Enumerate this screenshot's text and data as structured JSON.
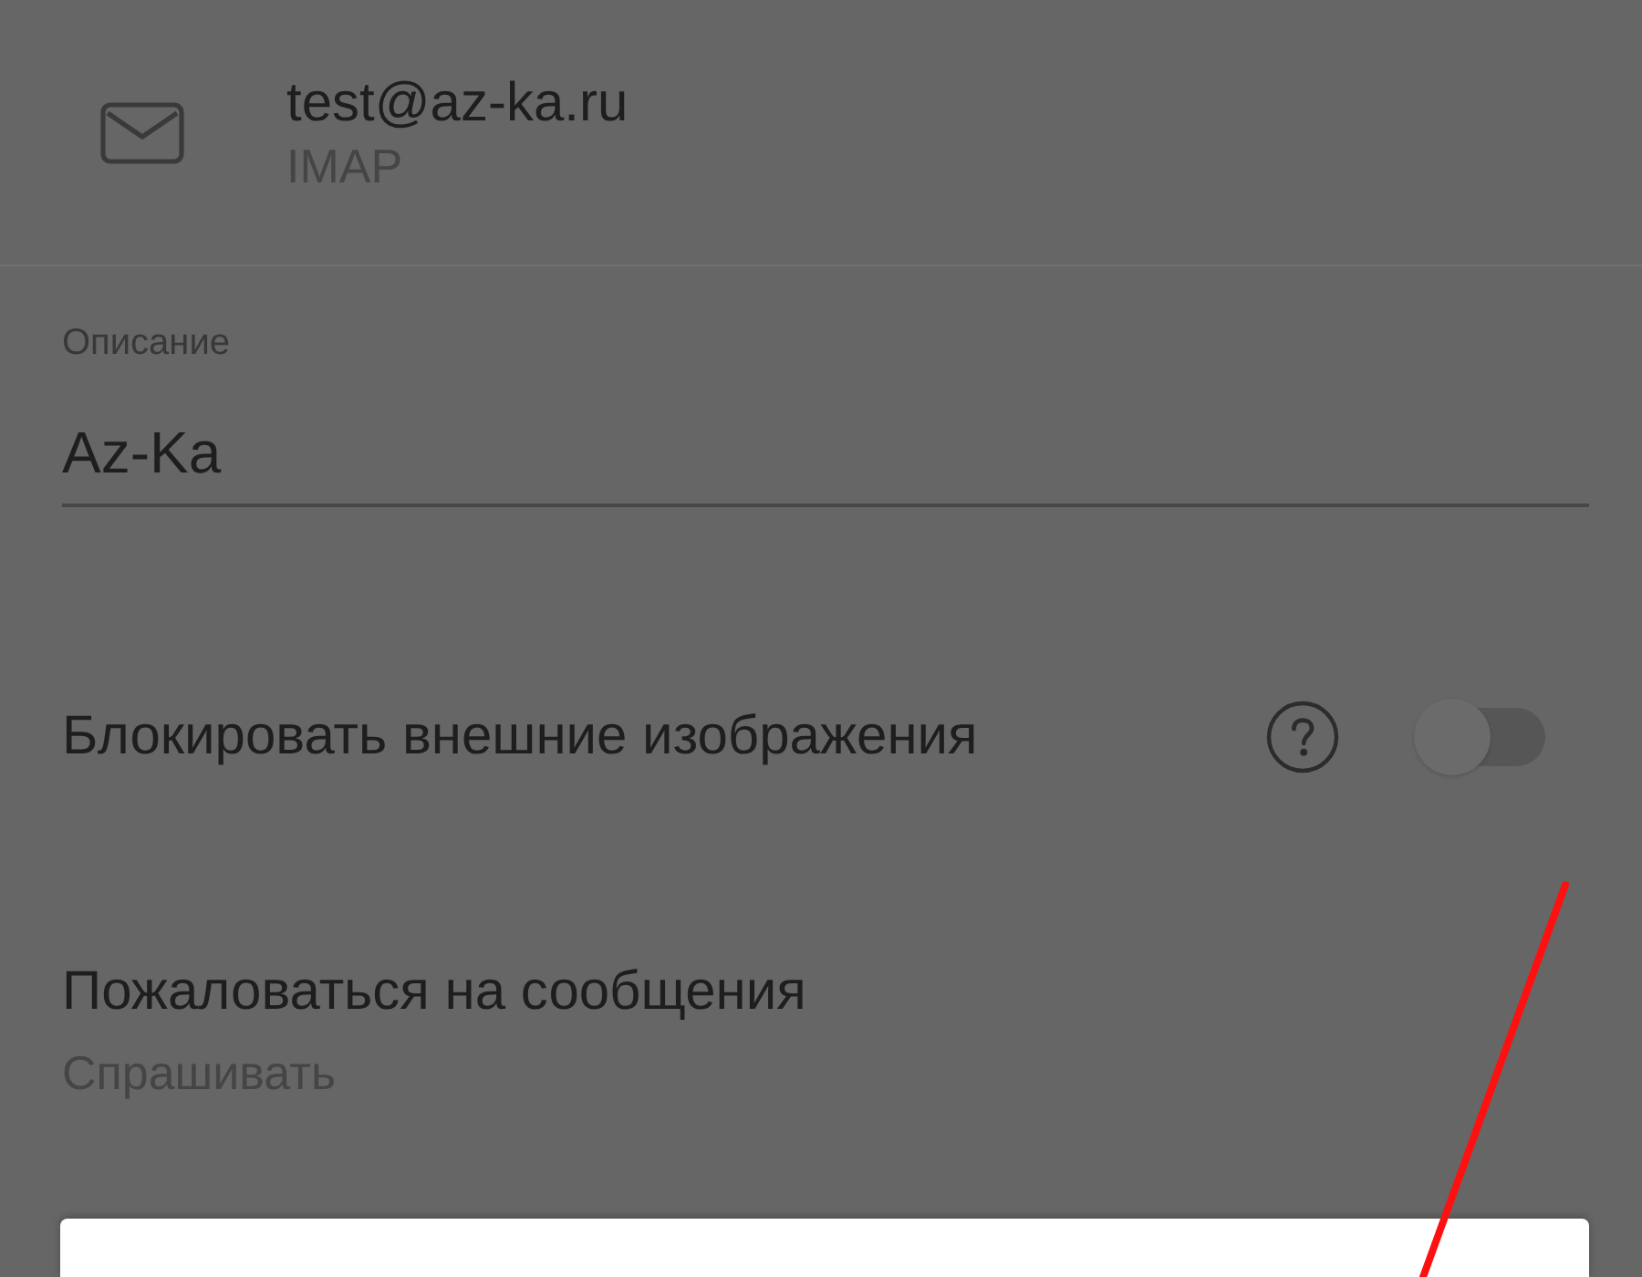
{
  "account": {
    "email": "test@az-ka.ru",
    "protocol": "IMAP"
  },
  "description_field": {
    "label": "Описание",
    "value": "Az-Ka"
  },
  "settings": [
    {
      "kind": "toggle",
      "label": "Блокировать внешние изображения",
      "help": true,
      "on": false
    },
    {
      "kind": "choice",
      "label": "Пожаловаться на сообщения",
      "value": "Спрашивать"
    }
  ],
  "dialog": {
    "open": true
  },
  "annotations": [
    {
      "kind": "line"
    }
  ]
}
